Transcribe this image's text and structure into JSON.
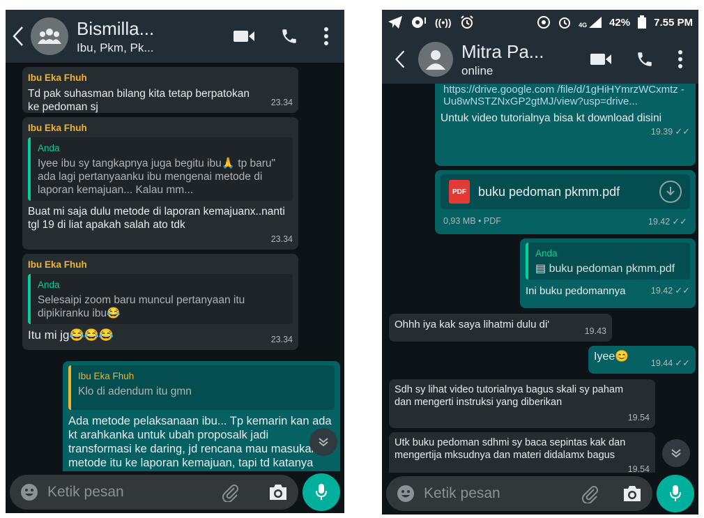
{
  "left": {
    "header": {
      "title": "Bismilla...",
      "subtitle": "Ibu, Pkm, Pk..."
    },
    "messages": [
      {
        "sender": "Ibu Eka Fhuh",
        "text": "Td pak suhasman bilang kita tetap berpatokan ke pedoman sj",
        "time": "23.34"
      },
      {
        "sender": "Ibu Eka Fhuh",
        "quote_name": "Anda",
        "quote_text": "Iyee ibu sy tangkapnya juga begitu ibu🙏 tp baru\" ada lagi pertanyaanku ibu mengenai metode di laporan kemajuan... Kalau mm...",
        "text": "Buat mi saja dulu metode di laporan kemajuanx..nanti tgl 19 di liat apakah salah ato tdk",
        "time": "23.34"
      },
      {
        "sender": "Ibu Eka Fhuh",
        "quote_name": "Anda",
        "quote_text": "Selesaipi zoom baru muncul pertanyaan itu dipikiranku ibu😂",
        "text": "Itu mi jg😂😂😂",
        "time": "23.34"
      },
      {
        "quote_name": "Ibu Eka Fhuh",
        "quote_text": "Klo di adendum itu gmn",
        "text": "Ada metode pelaksanaan ibu... Tp kemarin kan ada kt arahkanka untuk ubah proposalk jadi transformasi ke daring, jd rencana mau masukan metode itu ke laporan kemajuan, tapi td katanya adada pelaksanaan jd perlu di"
      }
    ],
    "input_placeholder": "Ketik pesan"
  },
  "right": {
    "status": {
      "battery": "42%",
      "clock": "7.55 PM",
      "network": "4G"
    },
    "header": {
      "title": "Mitra Pa...",
      "subtitle": "online"
    },
    "link_message": {
      "link": "https://drive.google.com /file/d/1gHiHYmrzWCxmtz -Uu8wNSTZNxGP2gtMJ/view?usp=drive...",
      "text": "Untuk video tutorialnya bisa kt download disini",
      "time": "19.39"
    },
    "doc_message": {
      "pdf_label": "PDF",
      "filename": "buku pedoman pkmm.pdf",
      "meta": "0,93 MB • PDF",
      "time": "19.42"
    },
    "reply_message": {
      "quote_name": "Anda",
      "quote_text": "▤ buku pedoman pkmm.pdf",
      "text": "Ini buku pedomannya",
      "time": "19.42"
    },
    "messages": [
      {
        "text": "Ohhh iya kak saya lihatmi dulu di'",
        "time": "19.43"
      },
      {
        "text": "Iyee😊",
        "time": "19.44"
      },
      {
        "text": "Sdh sy lihat video tutorialnya bagus skali sy paham dan mengerti instruksi yang diberikan",
        "time": "19.54"
      },
      {
        "text": "Utk buku pedoman sdhmi sy baca sepintas kak dan mengertija mksudnya dan materi didalamx bagus",
        "time": "19.54"
      }
    ],
    "input_placeholder": "Ketik pesan"
  },
  "colors": {
    "accent": "#00af9c",
    "outgoing": "#056162",
    "incoming": "#262d31",
    "header": "#232d36",
    "sender": "#f0b330"
  }
}
